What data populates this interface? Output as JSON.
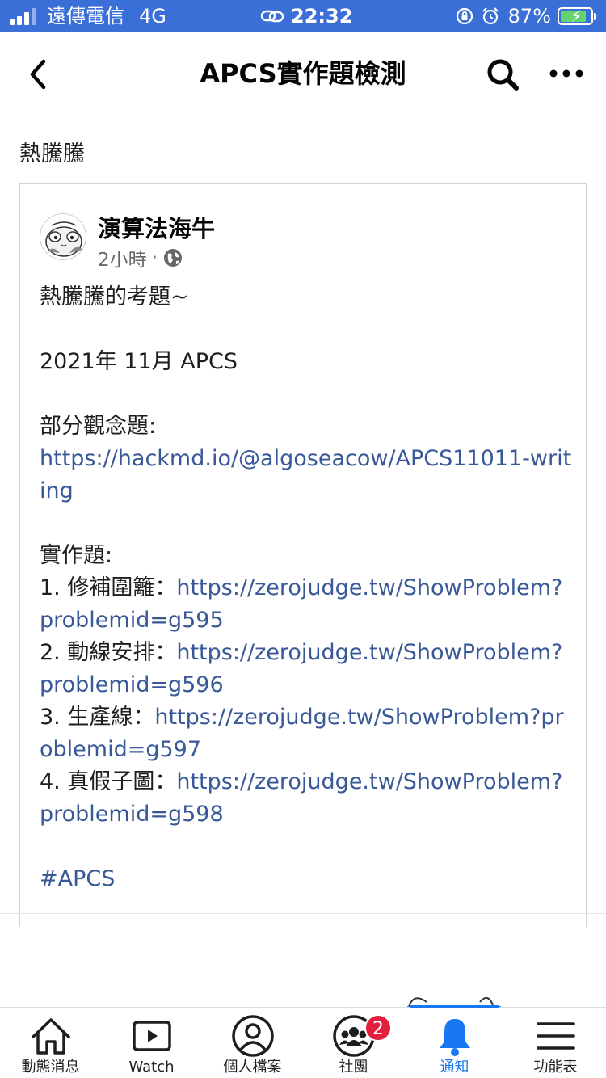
{
  "status_bar": {
    "carrier": "遠傳電信",
    "network": "4G",
    "time": "22:32",
    "battery_percent": "87%",
    "battery_level": 0.87
  },
  "header": {
    "title": "APCS實作題檢測",
    "back_icon": "chevron-left-icon",
    "search_icon": "search-icon",
    "more_icon": "more-horizontal-icon"
  },
  "post": {
    "text": "熱騰騰",
    "shared": {
      "author": "演算法海牛",
      "time": "2小時",
      "dot": "·",
      "privacy_icon": "globe-icon",
      "lines": [
        {
          "text": "熱騰騰的考題~"
        },
        {
          "text": ""
        },
        {
          "text": "2021年 11月 APCS"
        },
        {
          "text": ""
        },
        {
          "text": "部分觀念題:"
        },
        {
          "link": "https://hackmd.io/@algoseacow/APCS11011-writing"
        },
        {
          "text": ""
        },
        {
          "text": "實作題:"
        },
        {
          "text": "1. 修補圍籬：",
          "link": "https://zerojudge.tw/ShowProblem?problemid=g595"
        },
        {
          "text": "2. 動線安排：",
          "link": "https://zerojudge.tw/ShowProblem?problemid=g596"
        },
        {
          "text": "3. 生產線：",
          "link": "https://zerojudge.tw/ShowProblem?problemid=g597"
        },
        {
          "text": "4. 真假子圖：",
          "link": "https://zerojudge.tw/ShowProblem?problemid=g598"
        },
        {
          "text": ""
        },
        {
          "link": "#APCS"
        }
      ]
    }
  },
  "tab_bar": {
    "tabs": [
      {
        "label": "動態消息",
        "icon": "home-icon"
      },
      {
        "label": "Watch",
        "icon": "video-icon"
      },
      {
        "label": "個人檔案",
        "icon": "profile-icon"
      },
      {
        "label": "社團",
        "icon": "groups-icon",
        "badge": "2"
      },
      {
        "label": "通知",
        "icon": "bell-icon",
        "active": true
      },
      {
        "label": "功能表",
        "icon": "menu-icon"
      }
    ]
  },
  "colors": {
    "status_bar": "#3b6fd8",
    "link": "#385898",
    "active": "#1877f2",
    "badge": "#e41e3f"
  }
}
